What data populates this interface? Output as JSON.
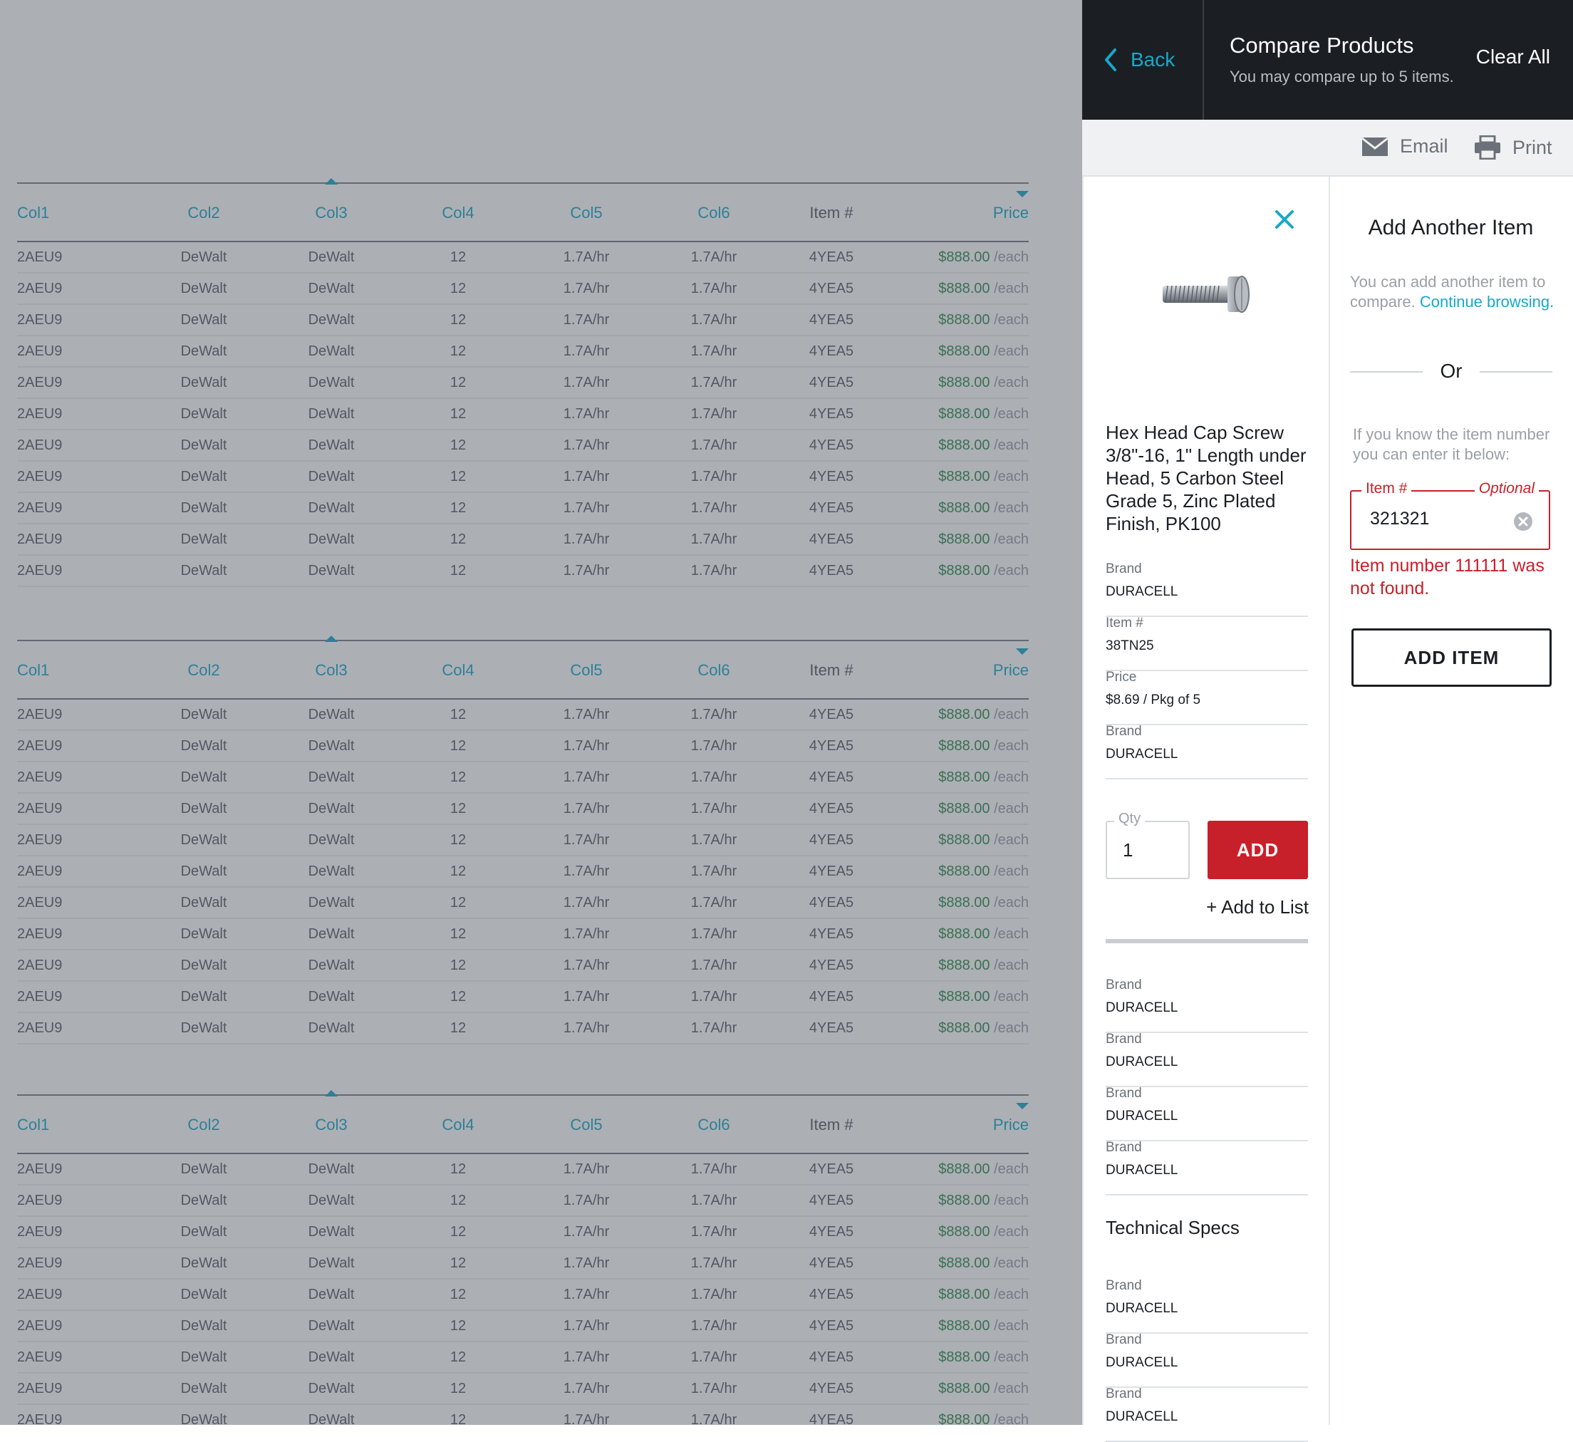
{
  "colors": {
    "accent": "#16a9c9",
    "danger": "#c8202a",
    "price": "#2e8b4a",
    "topbar": "#1b1f23"
  },
  "table": {
    "headers": [
      "Col1",
      "Col2",
      "Col3",
      "Col4",
      "Col5",
      "Col6",
      "Item #",
      "Price"
    ],
    "row": {
      "c1": "2AEU9",
      "c2": "DeWalt",
      "c3": "DeWalt",
      "c4": "12",
      "c5": "1.7A/hr",
      "c6": "1.7A/hr",
      "item": "4YEA5",
      "price": "$888.00",
      "unit": "/each"
    }
  },
  "header": {
    "back_label": "Back",
    "title": "Compare Products",
    "subtitle": "You may compare up to 5 items.",
    "clear_all": "Clear All"
  },
  "toolbar": {
    "email_label": "Email",
    "print_label": "Print"
  },
  "product": {
    "title": "Hex Head Cap Screw 3/8\"-16, 1\" Length under Head, 5 Carbon Steel Grade 5, Zinc Plated Finish, PK100",
    "specs": [
      {
        "label": "Brand",
        "value": "DURACELL"
      },
      {
        "label": "Item #",
        "value": "38TN25"
      },
      {
        "label": "Price",
        "value": "$8.69 / Pkg of 5"
      },
      {
        "label": "Brand",
        "value": "DURACELL"
      }
    ],
    "qty_label": "Qty",
    "qty_value": "1",
    "add_button": "ADD",
    "add_to_list": "+ Add to List",
    "more_specs": [
      {
        "label": "Brand",
        "value": "DURACELL"
      },
      {
        "label": "Brand",
        "value": "DURACELL"
      },
      {
        "label": "Brand",
        "value": "DURACELL"
      },
      {
        "label": "Brand",
        "value": "DURACELL"
      }
    ],
    "technical_specs_title": "Technical Specs",
    "tech_specs": [
      {
        "label": "Brand",
        "value": "DURACELL"
      },
      {
        "label": "Brand",
        "value": "DURACELL"
      },
      {
        "label": "Brand",
        "value": "DURACELL"
      }
    ]
  },
  "add_another": {
    "title": "Add Another Item",
    "hint_text": "You can add another item to compare.",
    "hint_link": "Continue browsing.",
    "or_label": "Or",
    "instructions": "If you know the item number you can enter it below:",
    "field_label": "Item #",
    "field_optional": "Optional",
    "field_value": "321321",
    "error_text": "Item number 111111 was not found.",
    "add_item_button": "ADD ITEM"
  }
}
